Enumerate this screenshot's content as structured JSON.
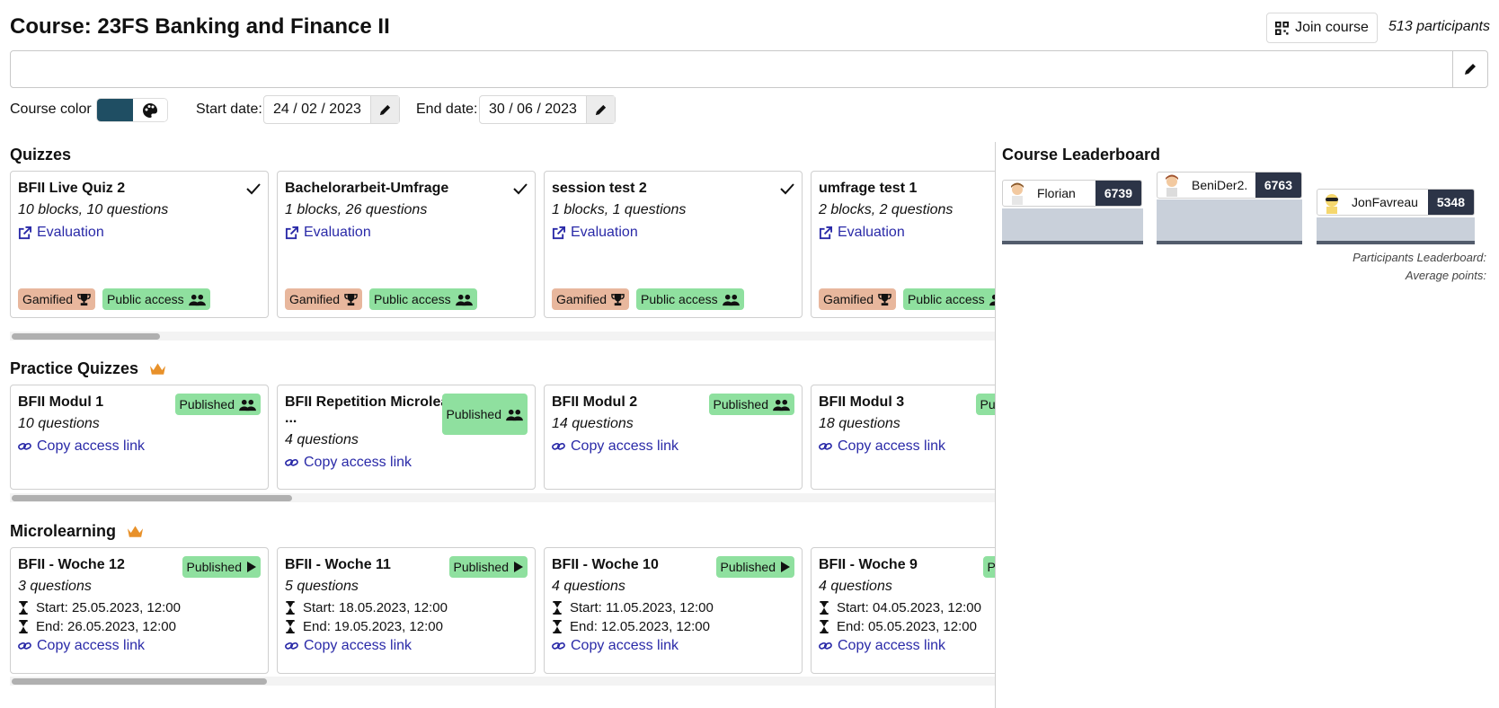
{
  "course": {
    "title": "Course: 23FS Banking and Finance II",
    "join_label": "Join course",
    "participants": "513 participants",
    "color_label": "Course color",
    "start_label": "Start date:",
    "start_date": "24 / 02 / 2023",
    "end_label": "End date:",
    "end_date": "30 / 06 / 2023",
    "accent_color": "#1f4e63"
  },
  "quizzes": {
    "title": "Quizzes",
    "items": [
      {
        "title": "BFII Live Quiz 2",
        "sub": "10 blocks, 10 questions",
        "link": "Evaluation",
        "gamified": "Gamified",
        "public": "Public access"
      },
      {
        "title": "Bachelorarbeit-Umfrage",
        "sub": "1 blocks, 26 questions",
        "link": "Evaluation",
        "gamified": "Gamified",
        "public": "Public access"
      },
      {
        "title": "session test 2",
        "sub": "1 blocks, 1 questions",
        "link": "Evaluation",
        "gamified": "Gamified",
        "public": "Public access"
      },
      {
        "title": "umfrage test 1",
        "sub": "2 blocks, 2 questions",
        "link": "Evaluation",
        "gamified": "Gamified",
        "public": "Public access"
      }
    ]
  },
  "practice": {
    "title": "Practice Quizzes",
    "items": [
      {
        "title": "BFII Modul 1",
        "sub": "10 questions",
        "link": "Copy access link",
        "status": "Published"
      },
      {
        "title": "BFII Repetition Microlear",
        "title2": "...",
        "sub": "4 questions",
        "link": "Copy access link",
        "status": "Published"
      },
      {
        "title": "BFII Modul 2",
        "sub": "14 questions",
        "link": "Copy access link",
        "status": "Published"
      },
      {
        "title": "BFII Modul 3",
        "sub": "18 questions",
        "link": "Copy access link",
        "status": "Published"
      }
    ]
  },
  "micro": {
    "title": "Microlearning",
    "items": [
      {
        "title": "BFII - Woche 12",
        "sub": "3 questions",
        "start": "Start: 25.05.2023, 12:00",
        "end": "End: 26.05.2023, 12:00",
        "link": "Copy access link",
        "status": "Published"
      },
      {
        "title": "BFII - Woche 11",
        "sub": "5 questions",
        "start": "Start: 18.05.2023, 12:00",
        "end": "End: 19.05.2023, 12:00",
        "link": "Copy access link",
        "status": "Published"
      },
      {
        "title": "BFII - Woche 10",
        "sub": "4 questions",
        "start": "Start: 11.05.2023, 12:00",
        "end": "End: 12.05.2023, 12:00",
        "link": "Copy access link",
        "status": "Published"
      },
      {
        "title": "BFII - Woche 9",
        "sub": "4 questions",
        "start": "Start: 04.05.2023, 12:00",
        "end": "End: 05.05.2023, 12:00",
        "link": "Copy access link",
        "status": "Published"
      }
    ]
  },
  "leaderboard": {
    "title": "Course Leaderboard",
    "podium": [
      {
        "name": "Florian",
        "score": "6739"
      },
      {
        "name": "BeniDer2.",
        "score": "6763"
      },
      {
        "name": "JonFavreau",
        "score": "5348"
      }
    ],
    "participants_label": "Participants Leaderboard:",
    "average_label": "Average points:"
  }
}
